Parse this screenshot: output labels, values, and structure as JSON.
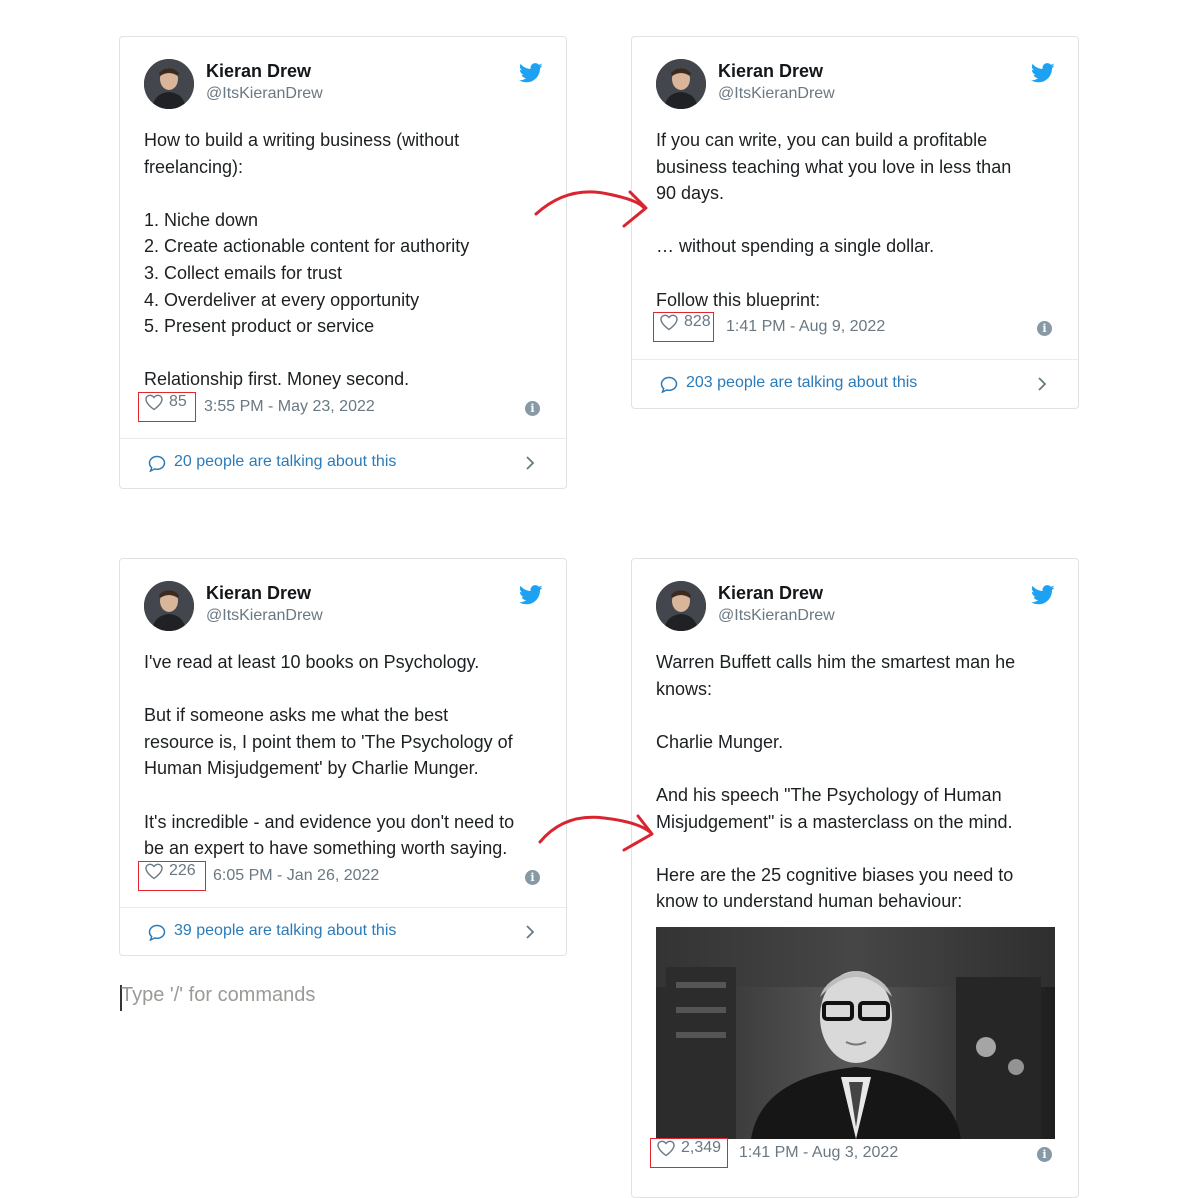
{
  "tweets": [
    {
      "author": "Kieran Drew",
      "handle": "@ItsKieranDrew",
      "lines": [
        "How to build a writing business (without",
        "freelancing):",
        "",
        "1. Niche down",
        "2. Create actionable content for authority",
        "3. Collect emails for trust",
        "4. Overdeliver at every opportunity",
        "5. Present product or service",
        "",
        "Relationship first. Money second."
      ],
      "likes": "85",
      "timestamp": "3:55 PM - May 23, 2022",
      "talking": "20 people are talking about this"
    },
    {
      "author": "Kieran Drew",
      "handle": "@ItsKieranDrew",
      "lines": [
        "If you can write, you can build a profitable",
        "business teaching what you love in less than",
        "90 days.",
        "",
        "… without spending a single dollar.",
        "",
        "Follow this blueprint:"
      ],
      "likes": "828",
      "timestamp": "1:41 PM - Aug 9, 2022",
      "talking": "203 people are talking about this"
    },
    {
      "author": "Kieran Drew",
      "handle": "@ItsKieranDrew",
      "lines": [
        "I've read at least 10 books on Psychology.",
        "",
        "But if someone asks me what the best",
        "resource is, I point them to 'The Psychology of",
        "Human Misjudgement' by Charlie Munger.",
        "",
        "It's incredible - and evidence you don't need to",
        "be an expert to have something worth saying."
      ],
      "likes": "226",
      "timestamp": "6:05 PM - Jan 26, 2022",
      "talking": "39 people are talking about this"
    },
    {
      "author": "Kieran Drew",
      "handle": "@ItsKieranDrew",
      "lines": [
        "Warren Buffett calls him the smartest man he",
        "knows:",
        "",
        "Charlie Munger.",
        "",
        "And his speech \"The Psychology of Human",
        "Misjudgement\" is a masterclass on the mind.",
        "",
        "Here are the 25 cognitive biases you need to",
        "know to understand human behaviour:"
      ],
      "likes": "2,349",
      "timestamp": "1:41 PM - Aug 3, 2022"
    }
  ],
  "editor": {
    "placeholder": "Type '/' for commands"
  },
  "colors": {
    "twitter_blue": "#1da1f2",
    "link_blue": "#2b7bb9",
    "highlight_red": "#e0262f",
    "muted_gray": "#697882"
  },
  "icons": [
    "twitter-bird-icon",
    "heart-icon",
    "info-icon",
    "speech-bubble-icon",
    "chevron-right-icon",
    "red-arrow-icon"
  ]
}
